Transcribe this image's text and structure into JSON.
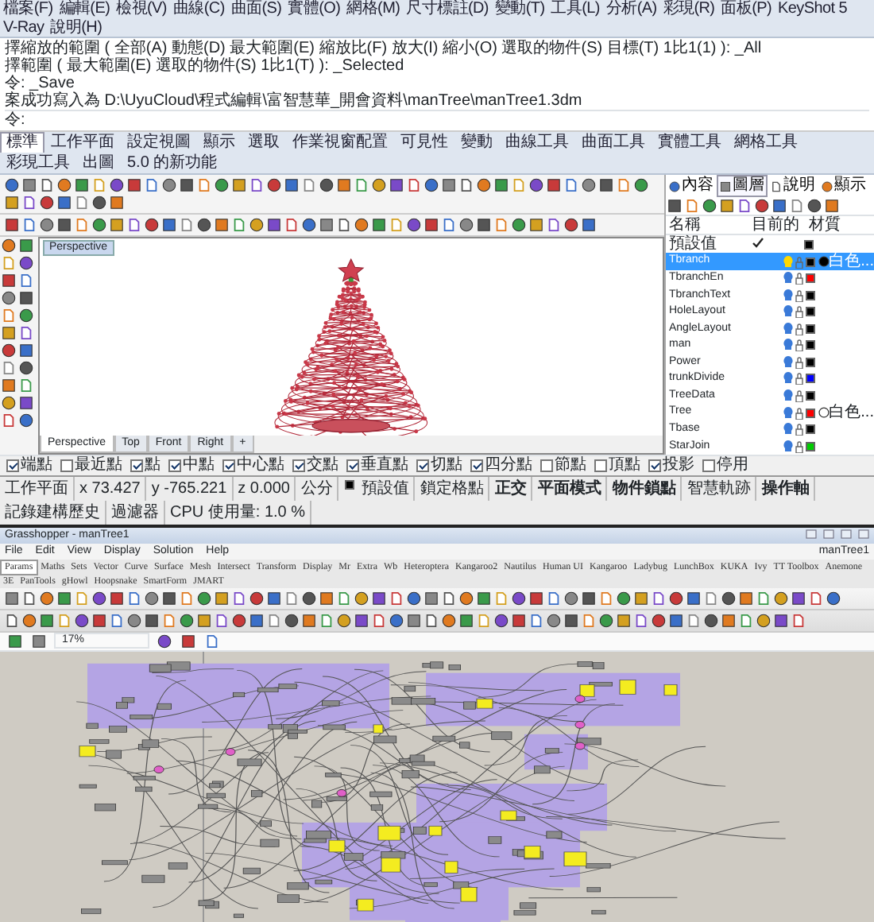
{
  "rhino": {
    "menu": [
      "檔案(F)",
      "編輯(E)",
      "檢視(V)",
      "曲線(C)",
      "曲面(S)",
      "實體(O)",
      "網格(M)",
      "尺寸標註(D)",
      "變動(T)",
      "工具(L)",
      "分析(A)",
      "彩現(R)",
      "面板(P)",
      "KeyShot 5",
      "V-Ray",
      "說明(H)"
    ],
    "command_history": [
      "擇縮放的範圍 ( 全部(A) 動態(D) 最大範圍(E) 縮放比(F) 放大(I) 縮小(O) 選取的物件(S) 目標(T) 1比1(1) ): _All",
      "擇範圍 ( 最大範圍(E) 選取的物件(S) 1比1(T) ): _Selected",
      "令: _Save",
      "案成功寫入為 D:\\UyuCloud\\程式編輯\\富智慧華_開會資料\\manTree\\manTree1.3dm"
    ],
    "command_prompt": "令:",
    "tabs": [
      {
        "label": "標準",
        "selected": true
      },
      {
        "label": "工作平面",
        "selected": false
      },
      {
        "label": "設定視圖",
        "selected": false
      },
      {
        "label": "顯示",
        "selected": false
      },
      {
        "label": "選取",
        "selected": false
      },
      {
        "label": "作業視窗配置",
        "selected": false
      },
      {
        "label": "可見性",
        "selected": false
      },
      {
        "label": "變動",
        "selected": false
      },
      {
        "label": "曲線工具",
        "selected": false
      },
      {
        "label": "曲面工具",
        "selected": false
      },
      {
        "label": "實體工具",
        "selected": false
      },
      {
        "label": "網格工具",
        "selected": false
      },
      {
        "label": "彩現工具",
        "selected": false
      },
      {
        "label": "出圖",
        "selected": false
      },
      {
        "label": "5.0 的新功能",
        "selected": false
      }
    ],
    "viewport": {
      "title": "Perspective"
    },
    "viewport_tabs": [
      {
        "label": "Perspective",
        "selected": true
      },
      {
        "label": "Top",
        "selected": false
      },
      {
        "label": "Front",
        "selected": false
      },
      {
        "label": "Right",
        "selected": false
      },
      {
        "label": "+",
        "selected": false
      }
    ],
    "layers_panel": {
      "tabs": [
        {
          "label": "內容",
          "selected": false
        },
        {
          "label": "圖層",
          "selected": true
        },
        {
          "label": "說明",
          "selected": false
        },
        {
          "label": "顯示",
          "selected": false
        }
      ],
      "columns": [
        "名稱",
        "目前的",
        "材質"
      ],
      "layers": [
        {
          "name": "預設值",
          "current": true,
          "selected": false,
          "color": "#000000"
        },
        {
          "name": "Tbranch",
          "current": false,
          "selected": true,
          "color": "#000000",
          "material": "白色..."
        },
        {
          "name": "TbranchEn",
          "current": false,
          "selected": false,
          "color": "#ff0000"
        },
        {
          "name": "TbranchText",
          "current": false,
          "selected": false,
          "color": "#000000"
        },
        {
          "name": "HoleLayout",
          "current": false,
          "selected": false,
          "color": "#000000"
        },
        {
          "name": "AngleLayout",
          "current": false,
          "selected": false,
          "color": "#000000"
        },
        {
          "name": "man",
          "current": false,
          "selected": false,
          "color": "#000000"
        },
        {
          "name": "Power",
          "current": false,
          "selected": false,
          "color": "#000000"
        },
        {
          "name": "trunkDivide",
          "current": false,
          "selected": false,
          "color": "#0000ff"
        },
        {
          "name": "TreeData",
          "current": false,
          "selected": false,
          "color": "#000000"
        },
        {
          "name": "Tree",
          "current": false,
          "selected": false,
          "color": "#ff0000",
          "material": "白色..."
        },
        {
          "name": "Tbase",
          "current": false,
          "selected": false,
          "color": "#000000"
        },
        {
          "name": "StarJoin",
          "current": false,
          "selected": false,
          "color": "#00cc00"
        }
      ]
    },
    "osnaps": [
      {
        "label": "端點",
        "checked": true
      },
      {
        "label": "最近點",
        "checked": false
      },
      {
        "label": "點",
        "checked": true
      },
      {
        "label": "中點",
        "checked": true
      },
      {
        "label": "中心點",
        "checked": true
      },
      {
        "label": "交點",
        "checked": true
      },
      {
        "label": "垂直點",
        "checked": true
      },
      {
        "label": "切點",
        "checked": true
      },
      {
        "label": "四分點",
        "checked": true
      },
      {
        "label": "節點",
        "checked": false
      },
      {
        "label": "頂點",
        "checked": false
      },
      {
        "label": "投影",
        "checked": true
      },
      {
        "label": "停用",
        "checked": false
      }
    ],
    "status_bar": {
      "plane": "工作平面",
      "x": "x 73.427",
      "y": "y -765.221",
      "z": "z 0.000",
      "units": "公分",
      "layer": "預設值",
      "toggles": [
        {
          "label": "鎖定格點",
          "on": false
        },
        {
          "label": "正交",
          "on": true
        },
        {
          "label": "平面模式",
          "on": true
        },
        {
          "label": "物件鎖點",
          "on": true
        },
        {
          "label": "智慧軌跡",
          "on": false
        },
        {
          "label": "操作軸",
          "on": true
        },
        {
          "label": "記錄建構歷史",
          "on": false
        },
        {
          "label": "過濾器",
          "on": false
        }
      ],
      "cpu": "CPU 使用量: 1.0 %"
    }
  },
  "grasshopper": {
    "title": "Grasshopper - manTree1",
    "menu": [
      "File",
      "Edit",
      "View",
      "Display",
      "Solution",
      "Help"
    ],
    "document": "manTree1",
    "tabs": [
      {
        "label": "Params",
        "selected": true
      },
      {
        "label": "Maths",
        "selected": false
      },
      {
        "label": "Sets",
        "selected": false
      },
      {
        "label": "Vector",
        "selected": false
      },
      {
        "label": "Curve",
        "selected": false
      },
      {
        "label": "Surface",
        "selected": false
      },
      {
        "label": "Mesh",
        "selected": false
      },
      {
        "label": "Intersect",
        "selected": false
      },
      {
        "label": "Transform",
        "selected": false
      },
      {
        "label": "Display",
        "selected": false
      },
      {
        "label": "Mr",
        "selected": false
      },
      {
        "label": "Extra",
        "selected": false
      },
      {
        "label": "Wb",
        "selected": false
      },
      {
        "label": "Heteroptera",
        "selected": false
      },
      {
        "label": "Kangaroo2",
        "selected": false
      },
      {
        "label": "Nautilus",
        "selected": false
      },
      {
        "label": "Human UI",
        "selected": false
      },
      {
        "label": "Kangaroo",
        "selected": false
      },
      {
        "label": "Ladybug",
        "selected": false
      },
      {
        "label": "LunchBox",
        "selected": false
      },
      {
        "label": "KUKA",
        "selected": false
      },
      {
        "label": "Ivy",
        "selected": false
      },
      {
        "label": "TT Toolbox",
        "selected": false
      },
      {
        "label": "Anemone",
        "selected": false
      },
      {
        "label": "3E",
        "selected": false
      },
      {
        "label": "PanTools",
        "selected": false
      },
      {
        "label": "gHowl",
        "selected": false
      },
      {
        "label": "Hoopsnake",
        "selected": false
      },
      {
        "label": "SmartForm",
        "selected": false
      },
      {
        "label": "JMART",
        "selected": false
      }
    ],
    "zoom": "17%"
  }
}
